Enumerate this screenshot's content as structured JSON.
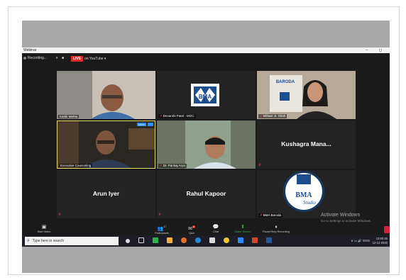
{
  "window": {
    "title": "Webinar",
    "controls": "– ◻"
  },
  "recording": {
    "status": "Recording...",
    "pause": "⏸",
    "stop": "■",
    "live_badge": "LIVE",
    "live_target": "on YouTube ▾"
  },
  "participants": [
    {
      "label": "Kartik Mehta",
      "muted": false
    },
    {
      "label": "Devarshi Patel - MOC",
      "muted": true
    },
    {
      "label": "Mihaer Jr. Shah",
      "muted": true
    },
    {
      "label": "Executive Counceling",
      "muted": false
    },
    {
      "label": "Dr. Pankaj Arya",
      "muted": true
    },
    {
      "label": "Kushagra Mana...",
      "muted": true
    },
    {
      "label": "Arun Iyer",
      "muted": true
    },
    {
      "label": "Rahul Kapoor",
      "muted": true
    },
    {
      "label": "BMA Baroda",
      "muted": true
    }
  ],
  "tile_badges": {
    "more": "More",
    "dots": "···"
  },
  "logo": {
    "bma": "BMA",
    "studio": "Studio",
    "banner": "BARODA"
  },
  "toolbar": [
    {
      "label": "Start Video",
      "icon": "video-off-icon",
      "glyph": "▣"
    },
    {
      "label": "Participants",
      "icon": "participants-icon",
      "glyph": "👥",
      "count": "17"
    },
    {
      "label": "Q&A",
      "icon": "qa-icon",
      "glyph": "✉",
      "count": "4"
    },
    {
      "label": "Chat",
      "icon": "chat-icon",
      "glyph": "💬"
    },
    {
      "label": "Share Screen",
      "icon": "share-screen-icon",
      "glyph": "⬆",
      "highlight": true
    },
    {
      "label": "Pause/Stop Recording",
      "icon": "recording-icon",
      "glyph": "⏸"
    }
  ],
  "watermark": {
    "title": "Activate Windows",
    "subtitle": "Go to Settings to activate Windows."
  },
  "taskbar": {
    "search_placeholder": "Type here to search",
    "tray": "∧ ▭ 🔊 ENG",
    "time": "13:00:45",
    "date": "12-12-2020"
  },
  "colors": {
    "live": "#e02b2b",
    "share": "#2bb24c",
    "accent": "#0e72ed",
    "active_border": "#e5d96b"
  }
}
